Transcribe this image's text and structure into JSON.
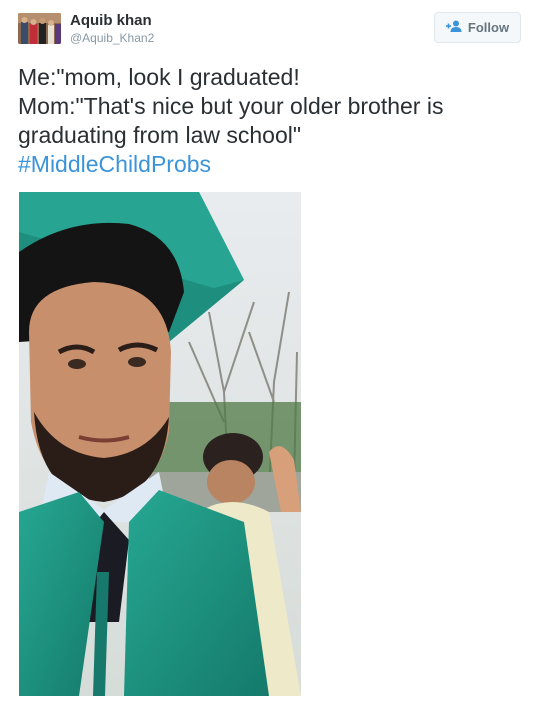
{
  "user": {
    "display_name": "Aquib khan",
    "screen_name": "@Aquib_Khan2"
  },
  "follow_button": {
    "label": "Follow",
    "icon": "add-user-icon"
  },
  "tweet": {
    "lines": [
      "Me:\"mom, look I graduated!",
      "Mom:\"That's nice but your older brother is",
      "graduating from law school\""
    ],
    "hashtag": "#MiddleChildProbs"
  },
  "colors": {
    "hashtag": "#3b94d9",
    "gown": "#1f9a86",
    "text": "#292f33",
    "muted": "#8899a6"
  }
}
